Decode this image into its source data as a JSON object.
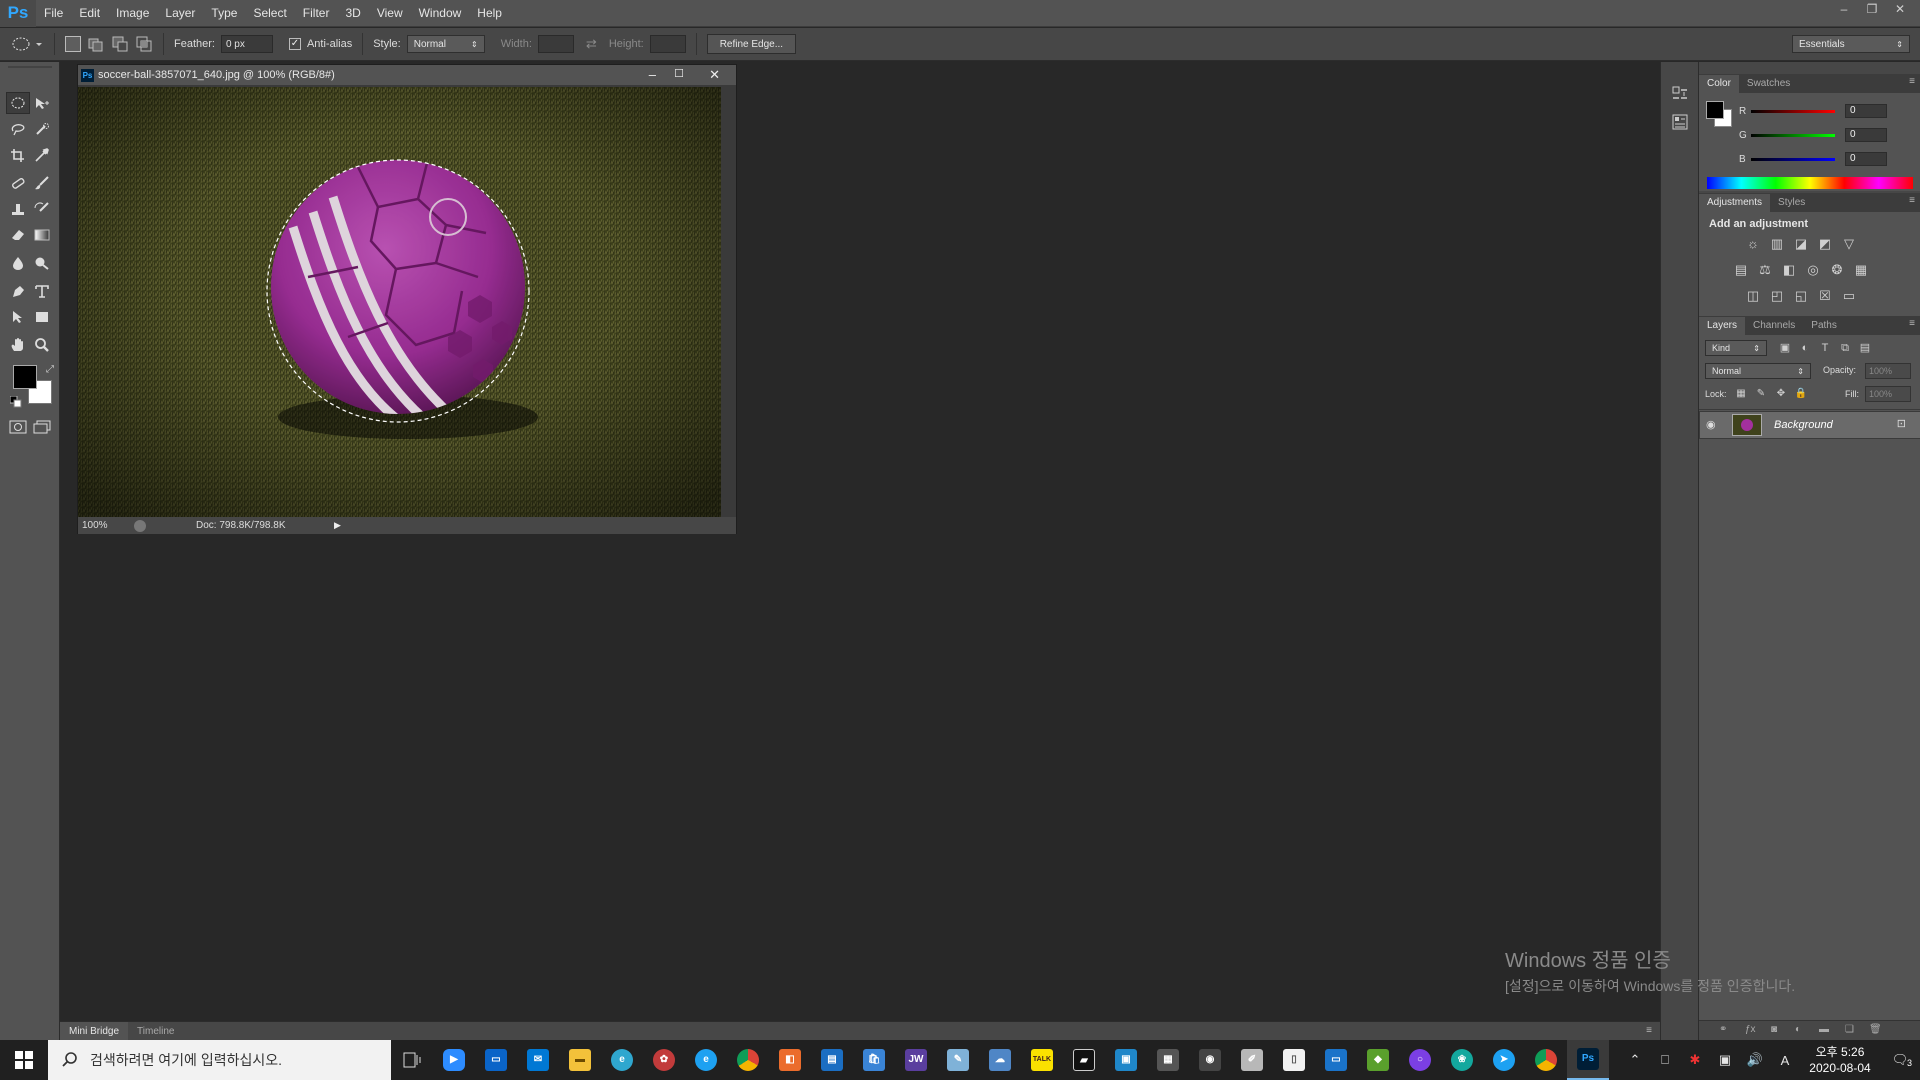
{
  "app": {
    "logo": "Ps",
    "menu": [
      "File",
      "Edit",
      "Image",
      "Layer",
      "Type",
      "Select",
      "Filter",
      "3D",
      "View",
      "Window",
      "Help"
    ],
    "window_controls": [
      "–",
      "❐",
      "✕"
    ]
  },
  "options": {
    "feather_label": "Feather:",
    "feather_value": "0 px",
    "antialias_label": "Anti-alias",
    "style_label": "Style:",
    "style_value": "Normal",
    "width_label": "Width:",
    "height_label": "Height:",
    "refine_edge": "Refine Edge...",
    "workspace": "Essentials"
  },
  "document": {
    "title": "soccer-ball-3857071_640.jpg @ 100% (RGB/8#)",
    "zoom": "100%",
    "doc_size": "Doc: 798.8K/798.8K",
    "ps_icon": "Ps"
  },
  "color_panel": {
    "tabs": [
      "Color",
      "Swatches"
    ],
    "channels": [
      {
        "label": "R",
        "value": "0"
      },
      {
        "label": "G",
        "value": "0"
      },
      {
        "label": "B",
        "value": "0"
      }
    ]
  },
  "adjustments_panel": {
    "tabs": [
      "Adjustments",
      "Styles"
    ],
    "heading": "Add an adjustment"
  },
  "layers_panel": {
    "tabs": [
      "Layers",
      "Channels",
      "Paths"
    ],
    "filter_kind": "Kind",
    "blend_mode": "Normal",
    "opacity_label": "Opacity:",
    "opacity_value": "100%",
    "lock_label": "Lock:",
    "fill_label": "Fill:",
    "fill_value": "100%",
    "layers": [
      {
        "name": "Background"
      }
    ]
  },
  "bottom_tabs": [
    "Mini Bridge",
    "Timeline"
  ],
  "watermark": {
    "line1": "Windows 정품 인증",
    "line2": "[설정]으로 이동하여 Windows를 정품 인증합니다."
  },
  "taskbar": {
    "search_placeholder": "검색하려면 여기에 입력하십시오.",
    "time": "오후 5:26",
    "date": "2020-08-04",
    "ime": "A",
    "notification_count": "3",
    "jw_label": "JW",
    "talk_label": "TALK",
    "ps_label": "Ps"
  },
  "colors": {
    "accent": "#31a8ff",
    "ball": "#a3309d",
    "grass": "#4a4d22"
  }
}
